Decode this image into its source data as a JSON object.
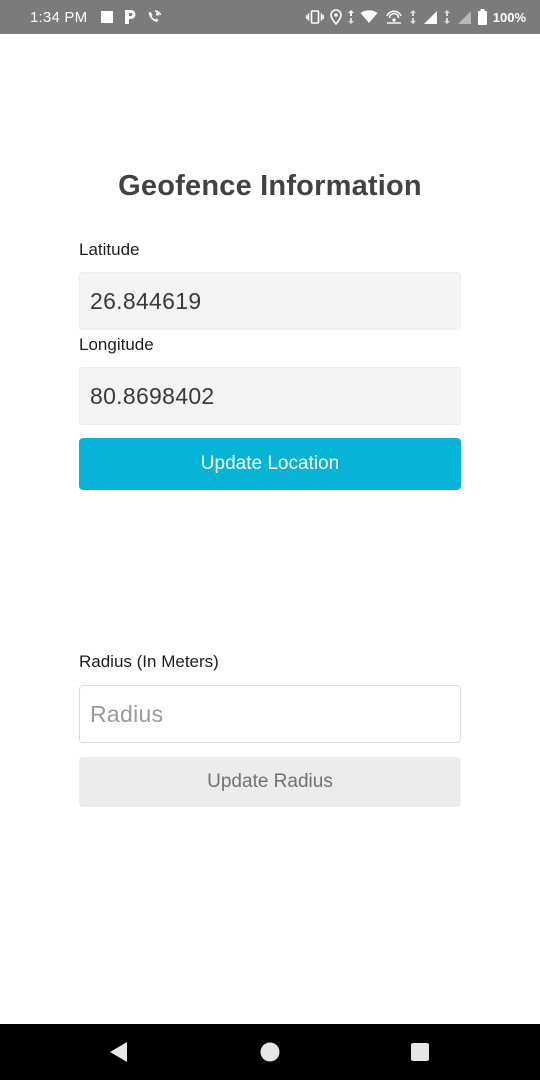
{
  "status_bar": {
    "time": "1:34 PM",
    "battery": "100%",
    "left_icons": [
      "square-notification-icon",
      "parking-icon",
      "phone-wifi-icon"
    ],
    "right_icons": [
      "vibrate-icon",
      "location-icon",
      "wifi-icon",
      "hotspot-icon",
      "cell-signal-icon",
      "cell-signal-empty-icon",
      "battery-icon"
    ]
  },
  "page": {
    "title": "Geofence Information"
  },
  "latitude": {
    "label": "Latitude",
    "value": "26.844619"
  },
  "longitude": {
    "label": "Longitude",
    "value": "80.8698402"
  },
  "update_location": {
    "label": "Update Location"
  },
  "radius": {
    "label": "Radius (In Meters)",
    "value": "",
    "placeholder": "Radius"
  },
  "update_radius": {
    "label": "Update Radius"
  },
  "nav_bar": {
    "icons": [
      "back-icon",
      "home-icon",
      "recents-icon"
    ]
  },
  "colors": {
    "status_bar": "#7b7b7b",
    "accent": "#08b4d6",
    "disabled_button": "#ececec",
    "nav_bar": "#000000"
  }
}
